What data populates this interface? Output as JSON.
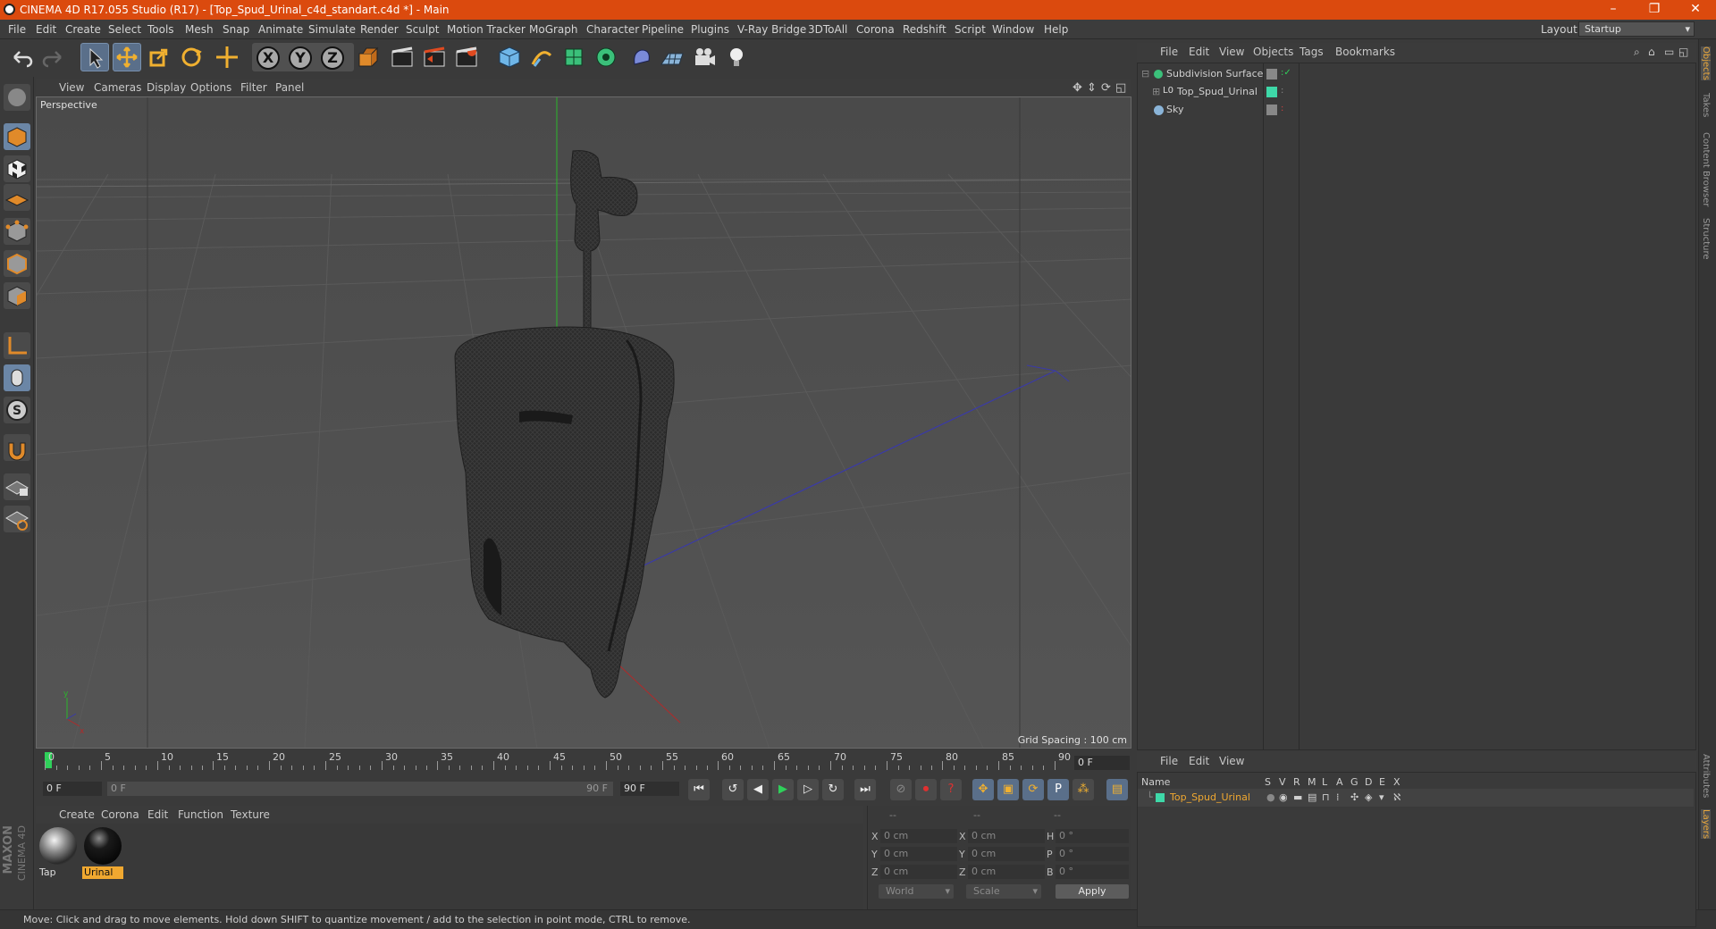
{
  "window": {
    "title": "CINEMA 4D R17.055 Studio (R17) - [Top_Spud_Urinal_c4d_standart.c4d *] - Main"
  },
  "menubar": {
    "items": [
      "File",
      "Edit",
      "Create",
      "Select",
      "Tools",
      "Mesh",
      "Snap",
      "Animate",
      "Simulate",
      "Render",
      "Sculpt",
      "Motion Tracker",
      "MoGraph",
      "Character",
      "Pipeline",
      "Plugins",
      "V-Ray Bridge",
      "3DToAll",
      "Corona",
      "Redshift",
      "Script",
      "Window",
      "Help"
    ],
    "layout_label": "Layout:",
    "layout_value": "Startup"
  },
  "viewport": {
    "menu": [
      "View",
      "Cameras",
      "Display",
      "Options",
      "Filter",
      "Panel"
    ],
    "label": "Perspective",
    "grid_spacing": "Grid Spacing : 100 cm"
  },
  "timeline": {
    "ticks": [
      "0",
      "5",
      "10",
      "15",
      "20",
      "25",
      "30",
      "35",
      "40",
      "45",
      "50",
      "55",
      "60",
      "65",
      "70",
      "75",
      "80",
      "85",
      "90"
    ],
    "end_field": "0 F",
    "start_field": "0 F",
    "range_start": "0 F",
    "range_end": "90 F",
    "max_field": "90 F"
  },
  "materials": {
    "menu": [
      "Create",
      "Corona",
      "Edit",
      "Function",
      "Texture"
    ],
    "items": [
      {
        "label": "Tap",
        "selected": false
      },
      {
        "label": "Urinal",
        "selected": true
      }
    ]
  },
  "coords": {
    "header": [
      "--",
      "--",
      "--"
    ],
    "rows": [
      {
        "a": "X",
        "a_val": "0 cm",
        "b": "X",
        "b_val": "0 cm",
        "c": "H",
        "c_val": "0 °"
      },
      {
        "a": "Y",
        "a_val": "0 cm",
        "b": "Y",
        "b_val": "0 cm",
        "c": "P",
        "c_val": "0 °"
      },
      {
        "a": "Z",
        "a_val": "0 cm",
        "b": "Z",
        "b_val": "0 cm",
        "c": "B",
        "c_val": "0 °"
      }
    ],
    "mode_world": "World",
    "mode_scale": "Scale",
    "apply": "Apply"
  },
  "objects": {
    "menu": [
      "File",
      "Edit",
      "View",
      "Objects",
      "Tags",
      "Bookmarks"
    ],
    "items": [
      {
        "name": "Subdivision Surface"
      },
      {
        "name": "Top_Spud_Urinal"
      },
      {
        "name": "Sky"
      }
    ]
  },
  "layers": {
    "menu": [
      "File",
      "Edit",
      "View"
    ],
    "columns": [
      "Name",
      "S",
      "V",
      "R",
      "M",
      "L",
      "A",
      "G",
      "D",
      "E",
      "X"
    ],
    "items": [
      {
        "name": "Top_Spud_Urinal"
      }
    ]
  },
  "sidetabs": [
    "Objects",
    "Takes",
    "Content Browser",
    "Structure",
    "Attributes",
    "Layers"
  ],
  "brand": {
    "maxon": "MAXON",
    "c4d": "CINEMA 4D"
  },
  "status": {
    "text": "Move: Click and drag to move elements. Hold down SHIFT to quantize movement / add to the selection in point mode, CTRL to remove."
  },
  "colors": {
    "accent": "#db4a0e",
    "layer_color": "#3ed8a8",
    "selected_label": "#f0a830"
  }
}
